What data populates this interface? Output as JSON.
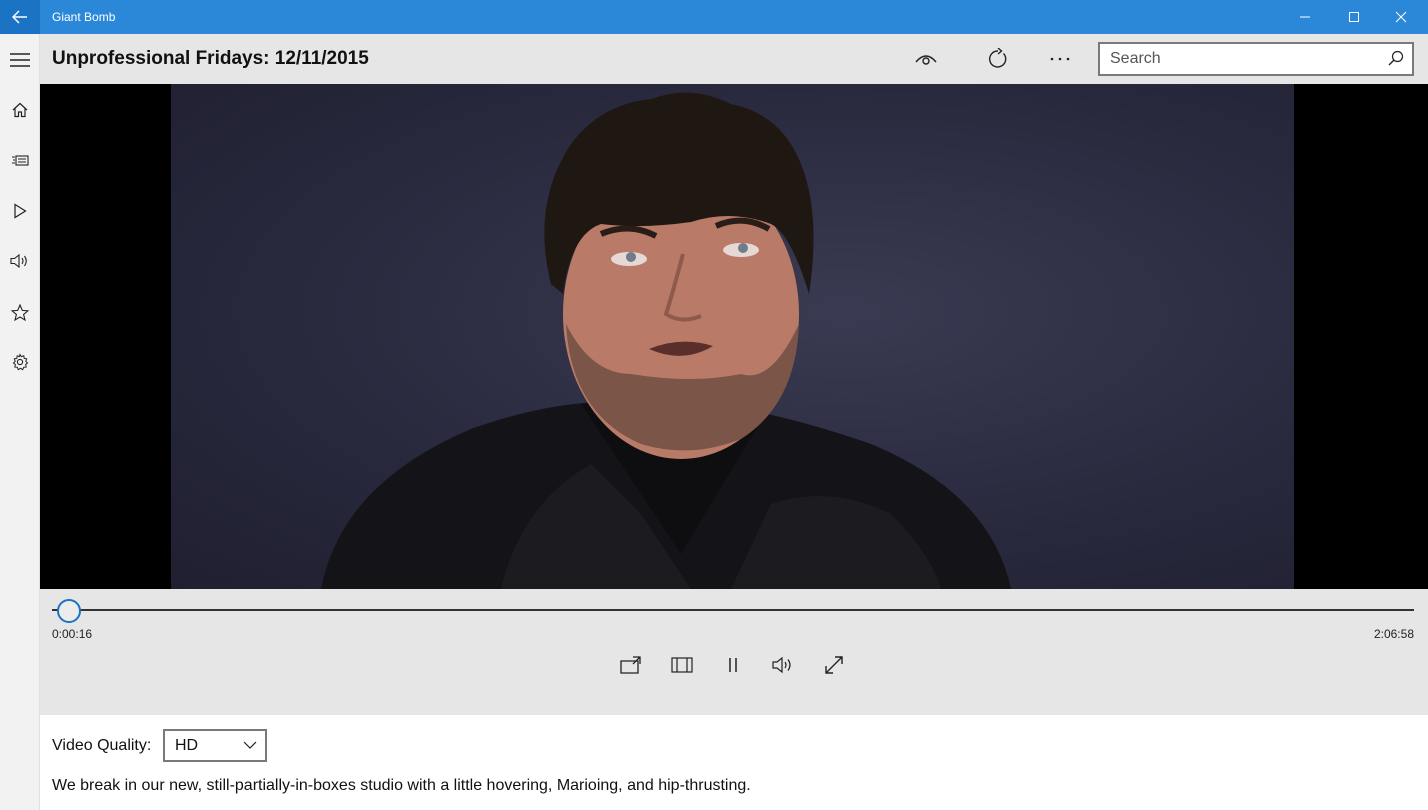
{
  "window": {
    "title": "Giant Bomb"
  },
  "header": {
    "title": "Unprofessional Fridays: 12/11/2015",
    "search_placeholder": "Search"
  },
  "player": {
    "current_time": "0:00:16",
    "duration": "2:06:58",
    "progress": 0.002
  },
  "details": {
    "quality_label": "Video Quality:",
    "quality_value": "HD",
    "description": "We break in our new, still-partially-in-boxes studio with a little hovering, Marioing, and hip-thrusting."
  },
  "colors": {
    "accent": "#2b88d8",
    "titlebar": "#2b88d8",
    "panel": "#e6e6e6"
  },
  "icons": {
    "rail": [
      "hamburger-icon",
      "home-icon",
      "news-icon",
      "play-icon",
      "audio-icon",
      "star-icon",
      "gear-icon"
    ],
    "header": [
      "eye-icon",
      "refresh-icon",
      "more-icon",
      "search-icon"
    ],
    "player": [
      "cast-icon",
      "aspect-icon",
      "pause-icon",
      "volume-icon",
      "fullscreen-icon"
    ]
  }
}
